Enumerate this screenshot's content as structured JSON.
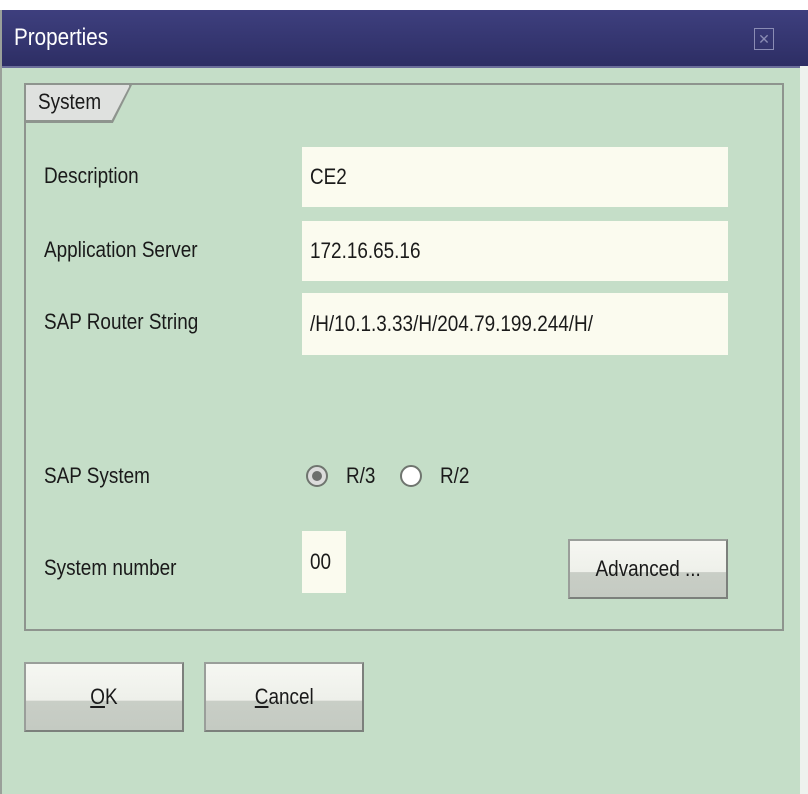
{
  "window": {
    "title": "Properties",
    "close_glyph": "✕"
  },
  "group": {
    "tab_label": "System"
  },
  "fields": {
    "description": {
      "label": "Description",
      "value": "CE2"
    },
    "app_server": {
      "label": "Application Server",
      "value": "172.16.65.16"
    },
    "router_string": {
      "label": "SAP Router String",
      "value": "/H/10.1.3.33/H/204.79.199.244/H/"
    },
    "sap_system": {
      "label": "SAP System",
      "options": [
        "R/3",
        "R/2"
      ],
      "selected": "R/3"
    },
    "system_number": {
      "label": "System number",
      "value": "00"
    }
  },
  "buttons": {
    "advanced": "Advanced ...",
    "ok": "OK",
    "cancel": "Cancel"
  },
  "colors": {
    "title_bar": "#34356f",
    "dialog_background": "#c5dec8",
    "field_background": "#fbfbef"
  }
}
